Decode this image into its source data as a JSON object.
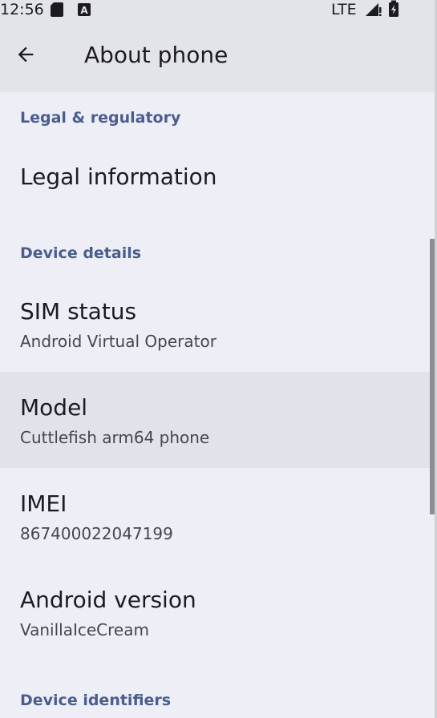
{
  "status_bar": {
    "time": "12:56",
    "network": "LTE",
    "icons": [
      "sd-card-icon",
      "a-notification-icon",
      "signal-icon",
      "battery-icon"
    ]
  },
  "app_bar": {
    "title": "About phone",
    "back_icon": "arrow-back-icon"
  },
  "sections": {
    "legal_header": "Legal & regulatory",
    "device_details_header": "Device details",
    "device_identifiers_header": "Device identifiers"
  },
  "items": {
    "legal_information": {
      "title": "Legal information"
    },
    "sim_status": {
      "title": "SIM status",
      "summary": "Android Virtual Operator"
    },
    "model": {
      "title": "Model",
      "summary": "Cuttlefish arm64 phone"
    },
    "imei": {
      "title": "IMEI",
      "summary": "867400022047199"
    },
    "android_version": {
      "title": "Android version",
      "summary": "VanillaIceCream"
    }
  },
  "colors": {
    "background": "#eeeff6",
    "bar_background": "#e3e3ea",
    "section_header": "#4a5d8e",
    "highlight_row": "#e2e2ea"
  }
}
